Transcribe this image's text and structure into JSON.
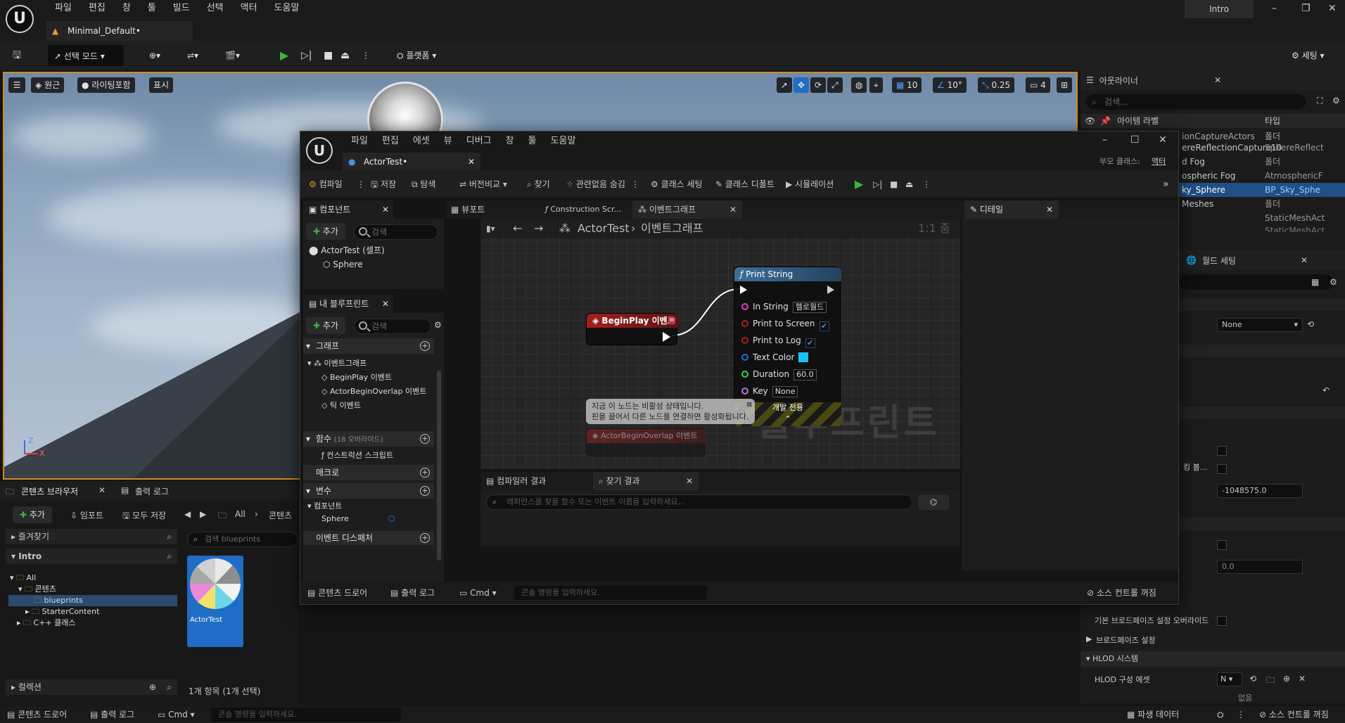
{
  "app": {
    "menu": [
      "파일",
      "편집",
      "창",
      "툴",
      "빌드",
      "선택",
      "액터",
      "도움말"
    ],
    "project_tab": "Minimal_Default•",
    "project_name": "Intro"
  },
  "toolbar": {
    "select_mode": "선택 모드",
    "platform": "플랫폼",
    "settings": "세팅"
  },
  "viewport": {
    "perspective": "원근",
    "lit": "라이팅포함",
    "show": "표시",
    "grid_value": "10",
    "angle_value": "10°",
    "scale_value": "0.25",
    "camera_speed": "4",
    "axis_z": "Z",
    "axis_x": "X"
  },
  "outliner": {
    "title": "아웃라이너",
    "search_placeholder": "검색...",
    "col_label": "아이템 라벨",
    "col_type": "타입",
    "rows": [
      {
        "label": "ionCaptureActors",
        "type": "폴더"
      },
      {
        "label": "ereReflectionCapture10",
        "type": "SphereReflect"
      },
      {
        "label": "d Fog",
        "type": "폴더"
      },
      {
        "label": "ospheric Fog",
        "type": "AtmosphericF"
      },
      {
        "label": "ky_Sphere",
        "type": "BP_Sky_Sphe"
      },
      {
        "label": "Meshes",
        "type": "폴더"
      },
      {
        "label": "",
        "type": "StaticMeshAct"
      },
      {
        "label": "",
        "type": "StaticMeshAct"
      }
    ],
    "world_settings": "월드 세팅",
    "none_value": "None",
    "value_neg": "-1048575.0",
    "value_zero": "0.0",
    "row_unknown": "킹 볼...",
    "partition_override": "기본 브로드페이즈 설정 오버라이드",
    "broadphase_settings": "브로드페이즈 설정",
    "hlod_system": "HLOD 시스템",
    "hlod_asset": "HLOD 구성 에셋",
    "hlod_value": "N",
    "hlod_sub": "없음"
  },
  "content_browser": {
    "tab": "콘텐츠 브라우저",
    "output_tab": "출력 로그",
    "add": "추가",
    "import": "임포트",
    "save_all": "모두 저장",
    "path_all": "All",
    "path_content": "콘텐츠",
    "favorites": "즐겨찾기",
    "intro": "Intro",
    "tree": [
      "All",
      "콘텐츠",
      "blueprints",
      "StarterContent",
      "C++ 클래스"
    ],
    "search_placeholder": "검색 blueprints",
    "asset_name": "ActorTest",
    "collections": "컬렉션",
    "item_count": "1개 항목 (1개 선택)"
  },
  "statusbar": {
    "drawer": "콘텐츠 드로어",
    "output": "출력 로그",
    "cmd": "Cmd",
    "console_placeholder": "콘솔 명령을 입력하세요.",
    "derived": "파생 데이터",
    "source_control": "소스 컨트롤 꺼짐"
  },
  "bp": {
    "menu": [
      "파일",
      "편집",
      "에셋",
      "뷰",
      "디버그",
      "창",
      "툴",
      "도움말"
    ],
    "tab": "ActorTest•",
    "parent_label": "부모 클래스:",
    "parent_value": "액터",
    "toolbar": {
      "compile": "컴파일",
      "save": "저장",
      "browse": "탐색",
      "diff": "버전비교",
      "find": "찾기",
      "hide_unrelated": "관련없음 숨김",
      "class_settings": "클래스 세팅",
      "class_defaults": "클래스 디폴트",
      "simulation": "시뮬레이션"
    },
    "components": {
      "title": "컴포넌트",
      "add": "추가",
      "search": "검색",
      "self": "ActorTest (셀프)",
      "sphere": "Sphere"
    },
    "my_blueprint": {
      "title": "내 블루프린트",
      "add": "추가",
      "search": "검색",
      "graph": "그래프",
      "event_graph": "이벤트그래프",
      "events": [
        "BeginPlay 이벤트",
        "ActorBeginOverlap 이벤트",
        "틱 이벤트"
      ],
      "functions": "함수",
      "functions_count": "(18 오버라이드)",
      "construction": "컨스트럭션 스크립트",
      "macros": "매크로",
      "variables": "변수",
      "components_cat": "컴포넌트",
      "var_sphere": "Sphere",
      "dispatchers": "이벤트 디스패처"
    },
    "tabs": {
      "viewport": "뷰포트",
      "construction": "Construction Scr...",
      "event_graph": "이벤트그래프",
      "details": "디테일"
    },
    "graph": {
      "breadcrumb_root": "ActorTest",
      "breadcrumb_leaf": "이벤트그래프",
      "zoom": "1:1 줌",
      "watermark": "블루프린트",
      "begin_play": "BeginPlay 이벤트",
      "print_string": "Print String",
      "in_string_label": "In String",
      "in_string_value": "헬로월드",
      "print_to_screen": "Print to Screen",
      "print_to_log": "Print to Log",
      "text_color": "Text Color",
      "text_color_hex": "#19c2f2",
      "duration_label": "Duration",
      "duration_value": "60.0",
      "key_label": "Key",
      "key_value": "None",
      "dev_only": "개발 전용",
      "disabled_note_1": "지금 이 노드는 비활성 상태입니다.",
      "disabled_note_2": "핀을 끌어서 다른 노드를 연결하면 활성화됩니다.",
      "overlap_node": "ActorBeginOverlap 이벤트"
    },
    "bottom": {
      "compiler_results": "컴파일러 결과",
      "find_results": "찾기 결과",
      "find_placeholder": "레퍼런스를 찾을 함수 또는 이벤트 이름을 입력하세요..."
    },
    "status": {
      "drawer": "콘텐츠 드로어",
      "output": "출력 로그",
      "cmd": "Cmd",
      "console_placeholder": "콘솔 명령을 입력하세요.",
      "source_control": "소스 컨트롤 꺼짐"
    }
  },
  "colors": {
    "accent_orange": "#d18b1e",
    "selection_blue": "#1f6dc4",
    "event_red": "#8f1d1d",
    "function_blue": "#35608c"
  }
}
